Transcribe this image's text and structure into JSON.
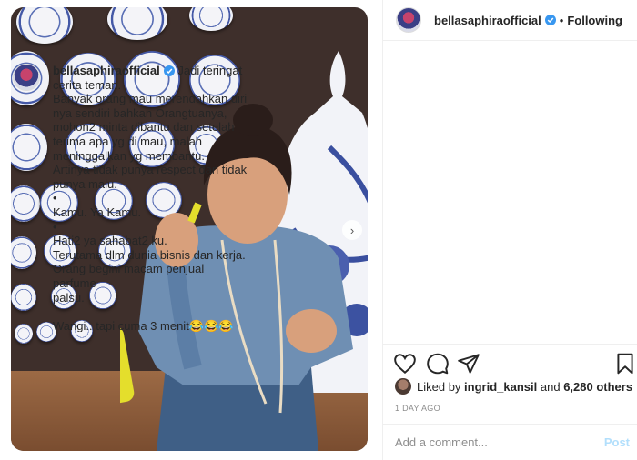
{
  "header": {
    "username": "bellasaphiraofficial",
    "separator": "•",
    "follow_status": "Following"
  },
  "caption": {
    "username": "bellasaphiraofficial",
    "lines": [
      "Jadi teringat",
      "cerita teman.",
      "Banyak orang mau merendahkan diri",
      "nya sendiri bahkan Orangtuanya,",
      "mohon2 minta dibantu dan setelah",
      "terima apa yg di mau, malah",
      "meninggalkan yg membantu.",
      "Artinya tidak punya respect dan tidak",
      "punya malu.",
      "•",
      "Kamu. Ya Kamu.",
      "•",
      "Hati2 ya sahabat2 ku.",
      "Terutama dlm dunia bisnis dan kerja.",
      "Orang begini macam penjual parfume",
      "palsu.",
      "",
      "Wangi.. tapi cuma 3 menit😂😂😂",
      "•"
    ]
  },
  "likes": {
    "prefix": "Liked by",
    "user": "ingrid_kansil",
    "middle": "and",
    "others": "6,280 others"
  },
  "timestamp": "1 DAY AGO",
  "comment": {
    "placeholder": "Add a comment...",
    "post_label": "Post"
  },
  "colors": {
    "verified_badge": "#3897f0",
    "post_button_disabled": "#b2dffc",
    "muted_text": "#8e8e8e"
  },
  "icons": [
    "heart-icon",
    "comment-icon",
    "share-icon",
    "bookmark-icon",
    "verified-icon",
    "chevron-right-icon"
  ]
}
